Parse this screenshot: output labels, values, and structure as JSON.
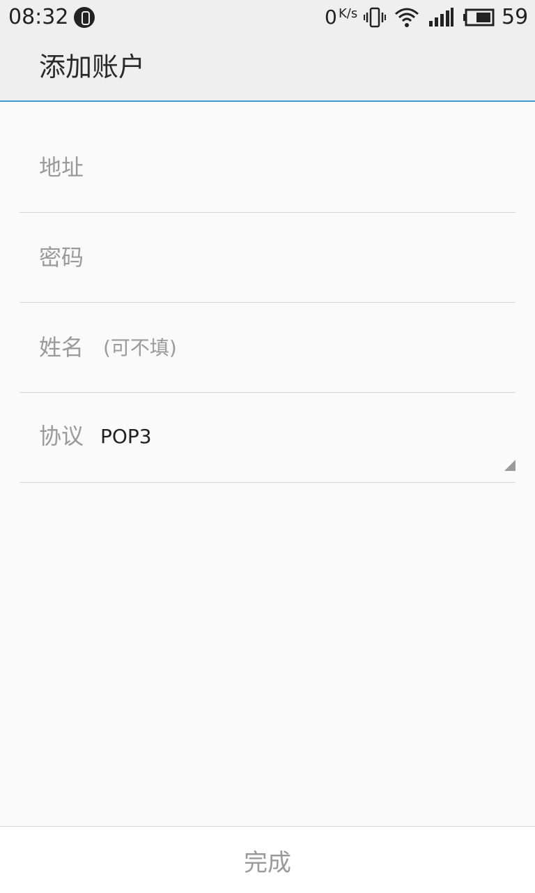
{
  "status_bar": {
    "time": "08:32",
    "net_speed": "0",
    "net_speed_unit": "K/s",
    "battery_level": "59",
    "icons": [
      "app-notification-icon",
      "vibrate-icon",
      "wifi-icon",
      "signal-icon",
      "battery-icon"
    ]
  },
  "header": {
    "title": "添加账户"
  },
  "form": {
    "address_placeholder": "地址",
    "password_placeholder": "密码",
    "name_placeholder": "姓名",
    "name_hint": "(可不填)",
    "protocol_label": "协议",
    "protocol_value": "POP3"
  },
  "footer": {
    "done_label": "完成"
  },
  "colors": {
    "accent": "#3d9ad6",
    "background": "#fafafa",
    "bar_background": "#efefef",
    "placeholder": "#9a9a9a",
    "divider": "#d4d4d4"
  }
}
